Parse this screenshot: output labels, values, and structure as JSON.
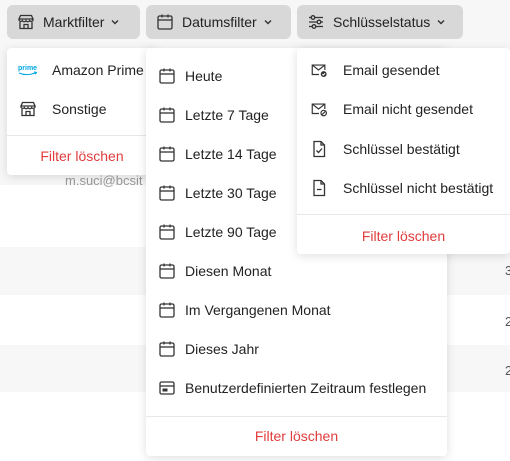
{
  "filters": {
    "market": {
      "label": "Marktfilter",
      "icon": "storefront-icon",
      "options": [
        {
          "label": "Amazon Prime",
          "icon": "amazon-prime-logo"
        },
        {
          "label": "Sonstige",
          "icon": "storefront-icon"
        }
      ],
      "clear_label": "Filter löschen"
    },
    "date": {
      "label": "Datumsfilter",
      "icon": "calendar-icon",
      "options": [
        {
          "label": "Heute",
          "icon": "calendar-icon"
        },
        {
          "label": "Letzte 7 Tage",
          "icon": "calendar-icon"
        },
        {
          "label": "Letzte 14 Tage",
          "icon": "calendar-icon"
        },
        {
          "label": "Letzte 30 Tage",
          "icon": "calendar-icon"
        },
        {
          "label": "Letzte 90 Tage",
          "icon": "calendar-icon"
        },
        {
          "label": "Diesen Monat",
          "icon": "calendar-icon"
        },
        {
          "label": "Im Vergangenen Monat",
          "icon": "calendar-icon"
        },
        {
          "label": "Dieses Jahr",
          "icon": "calendar-icon"
        },
        {
          "label": "Benutzerdefinierten Zeitraum festlegen",
          "icon": "date-range-icon"
        }
      ],
      "clear_label": "Filter löschen"
    },
    "key_status": {
      "label": "Schlüsselstatus",
      "icon": "sliders-icon",
      "options": [
        {
          "label": "Email gesendet",
          "icon": "email-sent-icon"
        },
        {
          "label": "Email nicht gesendet",
          "icon": "email-not-sent-icon"
        },
        {
          "label": "Schlüssel bestätigt",
          "icon": "file-check-icon"
        },
        {
          "label": "Schlüssel nicht bestätigt",
          "icon": "file-minus-icon"
        }
      ],
      "clear_label": "Filter löschen"
    }
  },
  "background": {
    "partial_email": "m.suci@bcsit",
    "right_edge_digits": [
      "3",
      "2",
      "2"
    ]
  },
  "colors": {
    "danger": "#e03c3c",
    "button_bg": "#d8d8d8",
    "prime_blue": "#00a8e1"
  }
}
